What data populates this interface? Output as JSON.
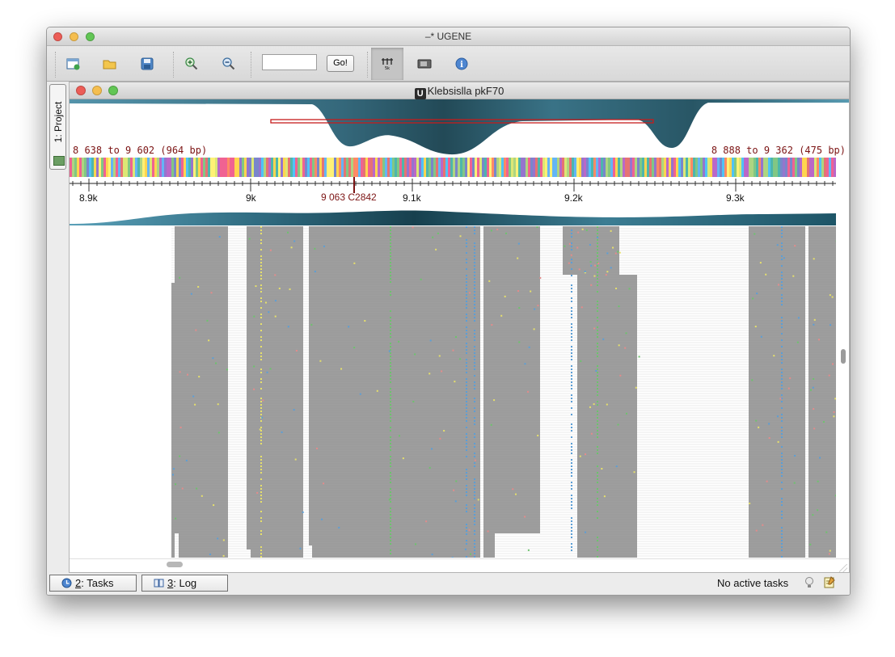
{
  "window": {
    "title": "–* UGENE"
  },
  "toolbar": {
    "icons": [
      "new-project-icon",
      "open-folder-icon",
      "save-icon",
      "zoom-in-icon",
      "zoom-out-icon",
      "ruler-toggle-icon",
      "video-icon",
      "info-icon"
    ],
    "goto_value": "",
    "go_label": "Go!"
  },
  "project_tab": {
    "label": "1: Project"
  },
  "document": {
    "title": "Klebsislla pkF70",
    "left_range": "8 638 to 9 602 (964 bp)",
    "right_range": "8 888 to 9 362 (475 bp)",
    "cursor_label": "9 063 C2842",
    "ruler_ticks": [
      "8.9k",
      "9k",
      "9.1k",
      "9.2k",
      "9.3k"
    ]
  },
  "statusbar": {
    "tasks_num": "2",
    "tasks_label": ": Tasks",
    "log_num": "3",
    "log_label": ": Log",
    "status": "No active tasks"
  },
  "colors": {
    "coverage": "#2e6a82",
    "read_gray": "#9e9e9e",
    "accent_red": "#7c1414"
  }
}
